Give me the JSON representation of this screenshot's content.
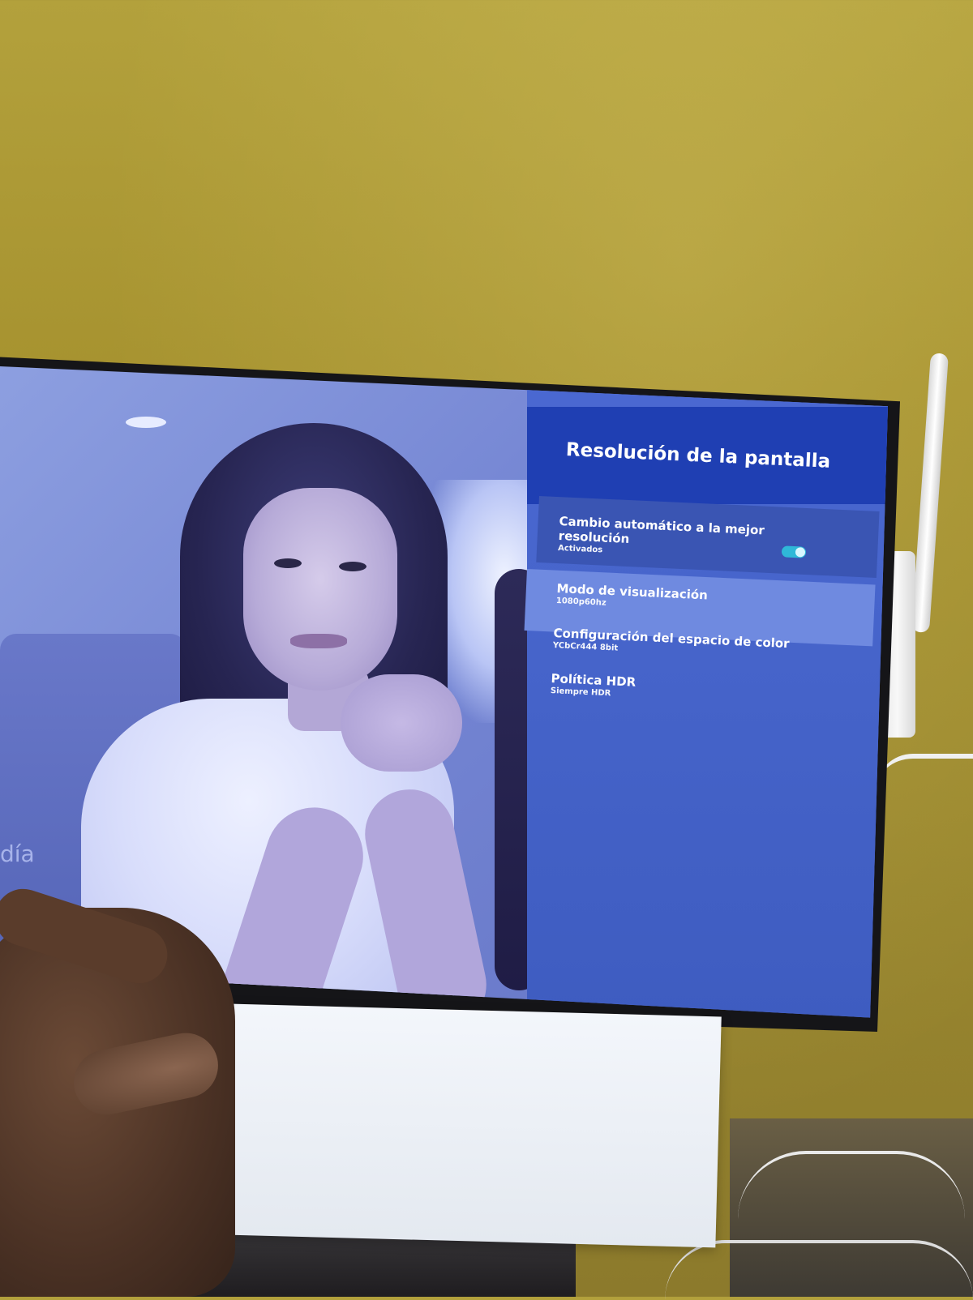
{
  "settings_panel": {
    "title": "Resolución de la pantalla",
    "items": [
      {
        "label": "Cambio automático a la mejor resolución",
        "value": "Activados",
        "toggle_on": true
      },
      {
        "label": "Modo de visualización",
        "value": "1080p60hz",
        "selected": true
      },
      {
        "label": "Configuración del espacio de color",
        "value": "YCbCr444 8bit"
      },
      {
        "label": "Política HDR",
        "value": "Siempre HDR"
      }
    ],
    "accent_color": "#2fb8d8",
    "header_color": "#1f3fb3"
  },
  "background_screen": {
    "partial_text": "día"
  }
}
